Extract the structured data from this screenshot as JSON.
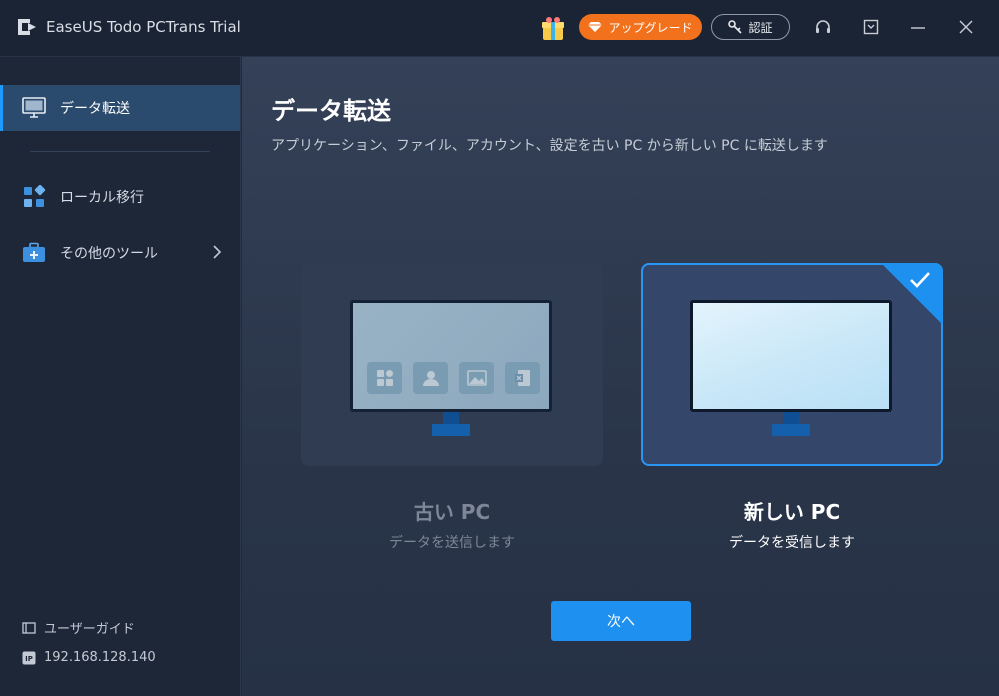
{
  "app": {
    "title": "EaseUS Todo PCTrans Trial"
  },
  "titlebar": {
    "upgrade_label": "アップグレード",
    "auth_label": "認証",
    "icons": [
      "gift-icon",
      "diamond-icon",
      "key-icon",
      "headset-icon",
      "dropdown-menu-icon",
      "minimize-icon",
      "close-icon"
    ]
  },
  "sidebar": {
    "items": [
      {
        "label": "データ転送",
        "icon": "monitor-icon",
        "active": true
      },
      {
        "label": "ローカル移行",
        "icon": "apps-grid-icon",
        "active": false
      },
      {
        "label": "その他のツール",
        "icon": "toolbox-icon",
        "active": false
      }
    ],
    "footer": {
      "guide_label": "ユーザーガイド",
      "ip_label": "192.168.128.140"
    }
  },
  "main": {
    "title": "データ転送",
    "subtitle": "アプリケーション、ファイル、アカウント、設定を古い PC から新しい PC に転送します",
    "cards": [
      {
        "title": "古い PC",
        "desc": "データを送信します",
        "selected": false
      },
      {
        "title": "新しい PC",
        "desc": "データを受信します",
        "selected": true
      }
    ],
    "next_label": "次へ"
  },
  "colors": {
    "accent": "#1e90f0",
    "upgrade": "#f2711c",
    "sidebar_active": "#2a4a6e"
  }
}
